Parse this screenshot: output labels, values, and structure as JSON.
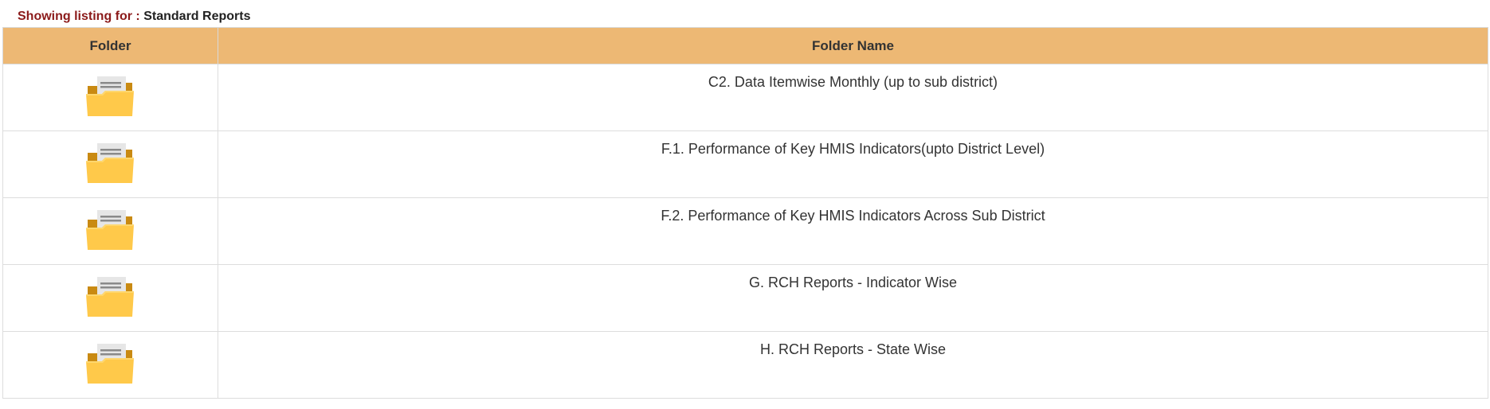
{
  "caption": {
    "label": "Showing listing for :",
    "value": "Standard Reports"
  },
  "table": {
    "headers": {
      "folder": "Folder",
      "folder_name": "Folder Name"
    },
    "rows": [
      {
        "icon": "open-folder-icon",
        "name": "C2. Data Itemwise Monthly (up to sub district)"
      },
      {
        "icon": "open-folder-icon",
        "name": "F.1. Performance of Key HMIS Indicators(upto District Level)"
      },
      {
        "icon": "open-folder-icon",
        "name": "F.2. Performance of Key HMIS Indicators Across Sub District"
      },
      {
        "icon": "open-folder-icon",
        "name": "G. RCH Reports - Indicator Wise"
      },
      {
        "icon": "open-folder-icon",
        "name": "H. RCH Reports - State Wise"
      }
    ]
  },
  "colors": {
    "header_bg": "#edb874",
    "caption_label": "#8b1a1a",
    "folder_front": "#ffc94a",
    "folder_back": "#c98a12",
    "paper": "#e6e6e6"
  }
}
